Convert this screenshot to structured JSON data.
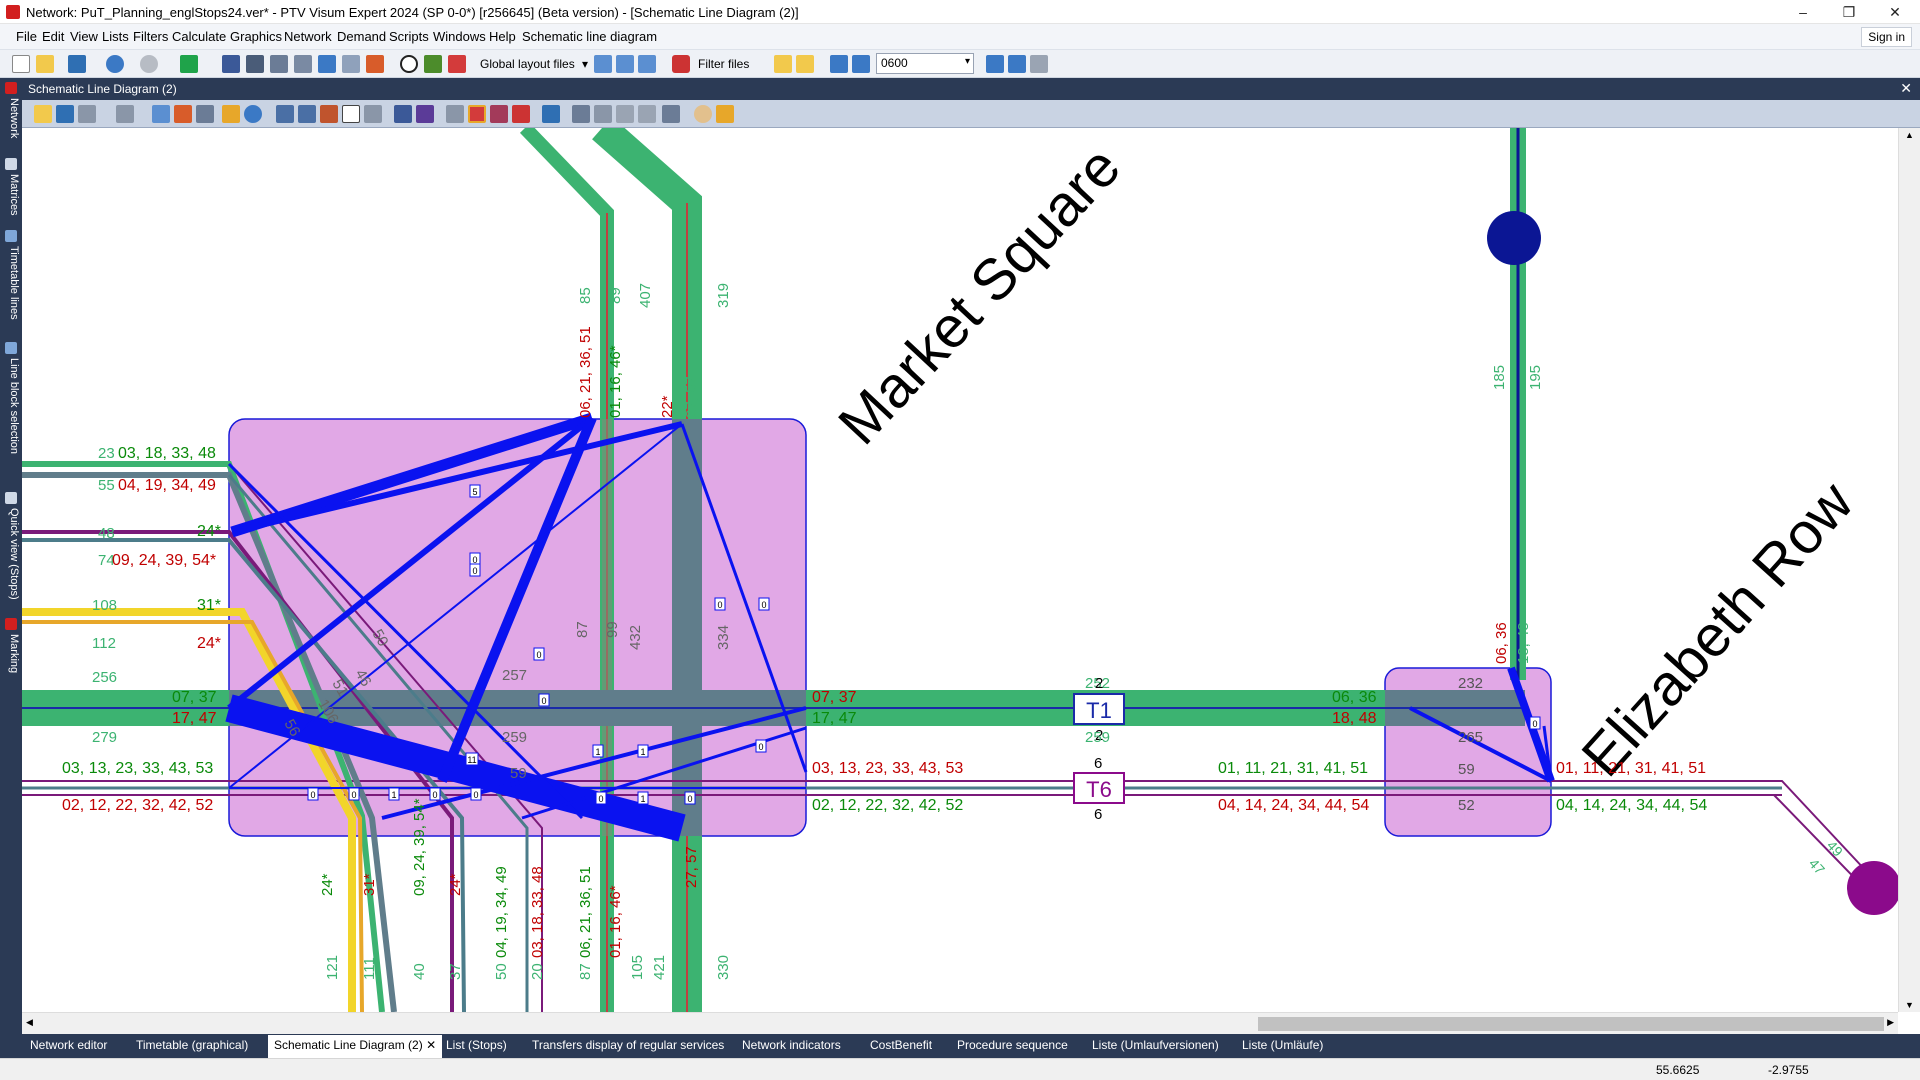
{
  "window": {
    "title": "Network: PuT_Planning_englStops24.ver* - PTV Visum Expert 2024 (SP 0-0*) [r256645] (Beta version) - [Schematic Line Diagram (2)]"
  },
  "menu": {
    "items": [
      "File",
      "Edit",
      "View",
      "Lists",
      "Filters",
      "Calculate",
      "Graphics",
      "Network",
      "Demand",
      "Scripts",
      "Windows",
      "Help",
      "Schematic line diagram"
    ],
    "signin": "Sign in"
  },
  "toolbar": {
    "global_layout_label": "Global layout files",
    "filter_files_label": "Filter files",
    "time_value": "0600"
  },
  "left_dock": {
    "tabs": [
      "Network",
      "Matrices",
      "Timetable lines",
      "Line block selection",
      "Quick view (Stops)",
      "Marking"
    ]
  },
  "doc_window": {
    "title": "Schematic Line Diagram (2)"
  },
  "diagram": {
    "stops": {
      "market_square": "Market Square",
      "elizabeth_row": "Elizabeth Row",
      "t1": "T1",
      "t6": "T6"
    },
    "labels": {
      "w1_vol": "23",
      "w1_lines": "03, 18, 33, 48",
      "w2_vol": "55",
      "w2_lines": "04, 19, 34, 49",
      "w3_vol": "48",
      "w3_lines": "24*",
      "w4_vol": "74",
      "w4_lines": "09, 24, 39, 54*",
      "w5_vol": "108",
      "w5_lines": "31*",
      "w6_vol": "112",
      "w6_lines": "24*",
      "w7_vol": "256",
      "w7_lines": "07, 37",
      "w8_vol": "279",
      "w8_lines": "17, 47",
      "w9_lines": "03, 13, 23, 33, 43, 53",
      "w9_vol": "87",
      "w10_lines": "02, 12, 22, 32, 42, 52",
      "w10_vol": "90",
      "e7_lines": "07, 37",
      "e8_lines": "17, 47",
      "e9_lines": "03, 13, 23, 33, 43, 53",
      "e10_lines": "02, 12, 22, 32, 42, 52",
      "t1_top_a": "252",
      "t1_top_b": "2",
      "t1_bot_a": "2",
      "t1_bot_b": "259",
      "t6_top": "6",
      "t6_bot": "6",
      "er_w_a": "06, 36",
      "er_w_b": "18, 48",
      "er_w_c": "01, 11, 21, 31, 41, 51",
      "er_w_d": "04, 14, 24, 34, 44, 54",
      "er_e_c": "01, 11, 21, 31, 41, 51",
      "er_e_d": "04, 14, 24, 34, 44, 54",
      "er_box_a": "232",
      "er_box_b": "265",
      "er_box_c": "59",
      "er_box_d": "52",
      "er_n_a": "06, 36",
      "er_n_b": "18, 48",
      "er_up_a": "185",
      "er_up_b": "195",
      "se_a": "49",
      "se_b": "47",
      "n_a": "85",
      "n_b": "06, 21, 36, 51",
      "n_c": "01, 16, 46*",
      "n_d": "89",
      "n_e": "407",
      "n_f": "22*",
      "n_g": "27, 57",
      "n_h": "319",
      "n_i": "17",
      "ms_in_a": "87",
      "ms_in_b": "99",
      "ms_in_c": "432",
      "ms_in_d": "334",
      "ms_in_e": "257",
      "ms_in_f": "259",
      "ms_in_g": "59",
      "ms_in_h": "50",
      "ms_in_i": "46",
      "ms_in_j": "51",
      "ms_in_k": "106",
      "ms_in_l": "56",
      "s_a": "24*",
      "s_b": "31*",
      "s_c": "09, 24, 39, 54*",
      "s_d": "24*",
      "s_e": "04, 19, 34, 49",
      "s_f": "03, 18, 33, 48",
      "s_g": "06, 21, 36, 51",
      "s_h": "01, 16, 46*",
      "s_i": "27, 57",
      "s_j": "121",
      "s_k": "111",
      "s_l": "40",
      "s_m": "37",
      "s_n": "50",
      "s_o": "20",
      "s_p": "87",
      "s_q": "105",
      "s_r": "421",
      "s_s": "330",
      "tr_a": "5",
      "tr_b": "0",
      "tr_c": "0",
      "tr_d": "0",
      "tr_e": "0",
      "tr_f": "0",
      "tr_g": "0",
      "tr_h": "11",
      "tr_i": "1",
      "tr_j": "1",
      "tr_k": "0",
      "tr_l": "0",
      "tr_m": "0",
      "tr_n": "0",
      "tr_o": "0",
      "tr_p": "1",
      "tr_q": "0",
      "tr_r": "1",
      "tr_s": "0",
      "tr_t": "0"
    }
  },
  "tabs": [
    "Network editor",
    "Timetable (graphical)",
    "Schematic Line Diagram (2)",
    "List (Stops)",
    "Transfers display of regular services",
    "Network indicators",
    "CostBenefit",
    "Procedure sequence",
    "Liste (Umlaufversionen)",
    "Liste (Umläufe)"
  ],
  "status": {
    "x": "55.6625",
    "y": "-2.9755"
  },
  "colors": {
    "green_band": "#3cb371",
    "gray_band": "#607d8b",
    "purple_box": "#e1a8e6",
    "blue_transfer": "#0a12f0",
    "label_green": "#0a8a0a",
    "label_red": "#c00000",
    "navy_node": "#0b1694",
    "purple_node": "#8b0a8b"
  }
}
